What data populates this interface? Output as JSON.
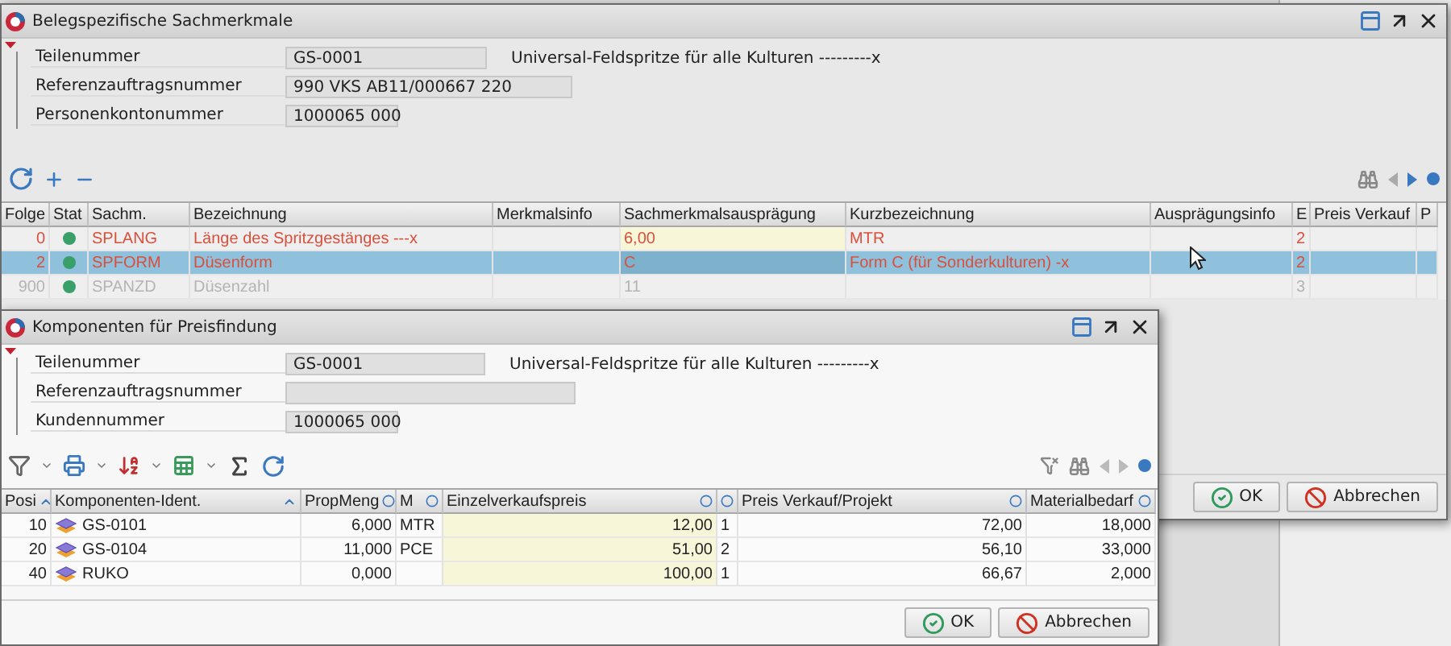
{
  "sachmerkmale_window": {
    "title": "Belegspezifische Sachmerkmale",
    "fields": [
      {
        "label": "Teilenummer",
        "value": "GS-0001"
      },
      {
        "label": "Referenzauftragsnummer",
        "value": "990 VKS AB11/000667 220"
      },
      {
        "label": "Personenkontonummer",
        "value": "1000065 000"
      }
    ],
    "description": "Universal-Feldspritze für alle Kulturen ---------x",
    "table": {
      "columns": [
        {
          "label": "Folge",
          "kind": "number"
        },
        {
          "label": "Stat",
          "kind": "status"
        },
        {
          "label": "Sachm.",
          "kind": "text"
        },
        {
          "label": "Bezeichnung",
          "kind": "text"
        },
        {
          "label": "Merkmalsinfo",
          "kind": "text"
        },
        {
          "label": "Sachmerkmalsausprägung",
          "kind": "text",
          "editable": true
        },
        {
          "label": "Kurzbezeichnung",
          "kind": "text"
        },
        {
          "label": "Ausprägungsinfo",
          "kind": "text"
        },
        {
          "label": "E",
          "kind": "text"
        },
        {
          "label": "Preis Verkauf",
          "kind": "text"
        },
        {
          "label": "P",
          "kind": "text"
        }
      ],
      "rows": [
        {
          "selected": false,
          "disabled": false,
          "cells": [
            "0",
            {
              "color": "#3aa06a"
            },
            "SPLANG",
            "Länge des Spritzgestänges ---x",
            null,
            "6,00",
            "MTR",
            null,
            "2",
            null,
            null
          ]
        },
        {
          "selected": true,
          "disabled": false,
          "cells": [
            "2",
            {
              "color": "#3aa06a"
            },
            "SPFORM",
            "Düsenform",
            null,
            "C",
            "Form C (für Sonderkulturen) -x",
            null,
            "2",
            null,
            null
          ]
        },
        {
          "selected": false,
          "disabled": true,
          "cells": [
            "900",
            {
              "color": "#3aa06a"
            },
            "SPANZD",
            "Düsenzahl",
            null,
            "11",
            null,
            null,
            "3",
            null,
            null
          ]
        }
      ]
    },
    "buttons": [
      {
        "label": "OK",
        "kind": "ok"
      },
      {
        "label": "Abbrechen",
        "kind": "cancel"
      }
    ]
  },
  "komponenten_window": {
    "title": "Komponenten für Preisfindung",
    "fields": [
      {
        "label": "Teilenummer",
        "value": "GS-0001"
      },
      {
        "label": "Referenzauftragsnummer"
      },
      {
        "label": "Kundennummer",
        "value": "1000065 000"
      }
    ],
    "description": "Universal-Feldspritze für alle Kulturen ---------x",
    "table": {
      "columns": [
        {
          "label": "Posi",
          "kind": "number",
          "sorted": true
        },
        {
          "label": "Komponenten-Ident.",
          "kind": "ident",
          "sorted": true
        },
        {
          "label": "PropMeng",
          "kind": "number",
          "sorted": false
        },
        {
          "label": "M",
          "kind": "text",
          "sorted": false
        },
        {
          "label": "Einzelverkaufspreis",
          "kind": "number",
          "sorted": false,
          "editable": true
        },
        {
          "kind": "text",
          "sorted": false
        },
        {
          "label": "Preis Verkauf/Projekt",
          "kind": "number",
          "sorted": false
        },
        {
          "label": "Materialbedarf",
          "kind": "number",
          "sorted": false
        }
      ],
      "rows": [
        {
          "selected": false,
          "disabled": false,
          "cells": [
            "10",
            "GS-0101",
            "6,000",
            "MTR",
            "12,00",
            "1",
            "72,00",
            "18,000"
          ]
        },
        {
          "selected": false,
          "disabled": false,
          "cells": [
            "20",
            "GS-0104",
            "11,000",
            "PCE",
            "51,00",
            "2",
            "56,10",
            "33,000"
          ]
        },
        {
          "selected": false,
          "disabled": false,
          "cells": [
            "40",
            "RUKO",
            "0,000",
            null,
            "100,00",
            "1",
            "66,67",
            "2,000"
          ]
        }
      ]
    },
    "buttons": [
      {
        "label": "OK",
        "kind": "ok"
      },
      {
        "label": "Abbrechen",
        "kind": "cancel"
      }
    ]
  }
}
